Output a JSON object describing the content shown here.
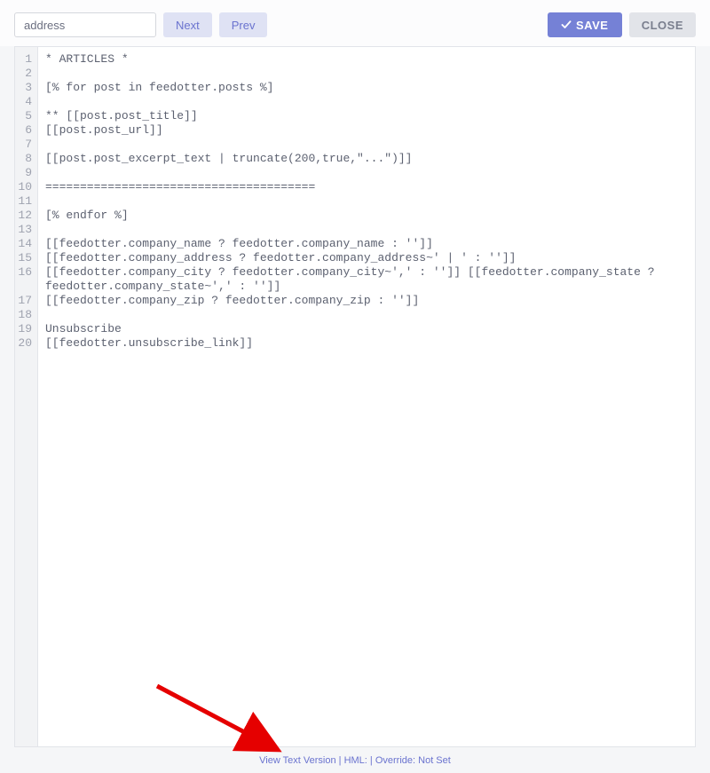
{
  "toolbar": {
    "search_value": "address",
    "next_label": "Next",
    "prev_label": "Prev",
    "save_label": "SAVE",
    "close_label": "CLOSE"
  },
  "editor": {
    "lines": [
      "* ARTICLES *",
      "",
      "[% for post in feedotter.posts %]",
      "",
      "** [[post.post_title]]",
      "[[post.post_url]]",
      "",
      "[[post.post_excerpt_text | truncate(200,true,\"...\")]]",
      "",
      "=======================================",
      "",
      "[% endfor %]",
      "",
      "[[feedotter.company_name ? feedotter.company_name : '']]",
      "[[feedotter.company_address ? feedotter.company_address~' | ' : '']]",
      "[[feedotter.company_city ? feedotter.company_city~',' : '']] [[feedotter.company_state ? feedotter.company_state~',' : '']]",
      "[[feedotter.company_zip ? feedotter.company_zip : '']]",
      "",
      "Unsubscribe",
      "[[feedotter.unsubscribe_link]]"
    ]
  },
  "footer": {
    "view_label": "View Text Version",
    "hml_label": "HML:",
    "override_label": "Override: Not Set"
  }
}
